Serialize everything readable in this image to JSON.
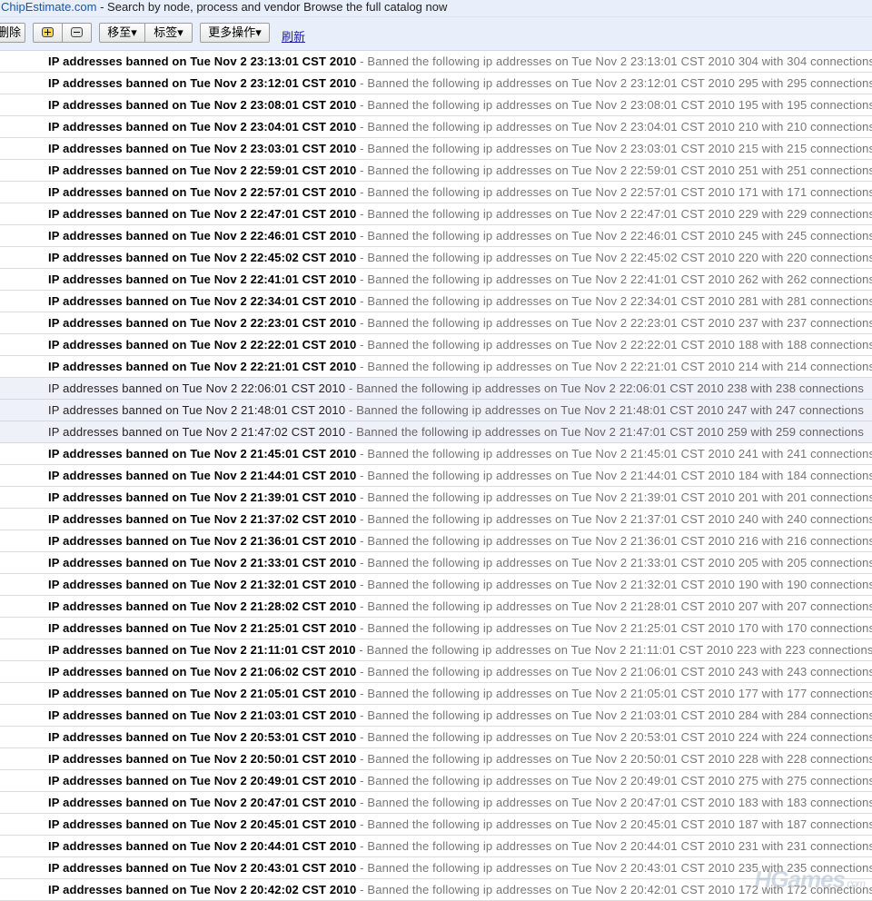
{
  "ad": {
    "link_text": "ChipEstimate.com",
    "text": " - Search by node, process and vendor Browse the full catalog now"
  },
  "toolbar": {
    "delete_label": "删除",
    "move_to_label": "移至▾",
    "labels_label": "标签▾",
    "more_actions_label": "更多操作▾",
    "refresh_label": "刷新"
  },
  "emails": [
    {
      "subject": "IP addresses banned on Tue Nov 2 23:13:01 CST 2010",
      "snippet": " - Banned the following ip addresses on Tue Nov 2 23:13:01 CST 2010 304 with 304 connections",
      "read": false
    },
    {
      "subject": "IP addresses banned on Tue Nov 2 23:12:01 CST 2010",
      "snippet": " - Banned the following ip addresses on Tue Nov 2 23:12:01 CST 2010 295 with 295 connections",
      "read": false
    },
    {
      "subject": "IP addresses banned on Tue Nov 2 23:08:01 CST 2010",
      "snippet": " - Banned the following ip addresses on Tue Nov 2 23:08:01 CST 2010 195 with 195 connections",
      "read": false
    },
    {
      "subject": "IP addresses banned on Tue Nov 2 23:04:01 CST 2010",
      "snippet": " - Banned the following ip addresses on Tue Nov 2 23:04:01 CST 2010 210 with 210 connections",
      "read": false
    },
    {
      "subject": "IP addresses banned on Tue Nov 2 23:03:01 CST 2010",
      "snippet": " - Banned the following ip addresses on Tue Nov 2 23:03:01 CST 2010 215 with 215 connections",
      "read": false
    },
    {
      "subject": "IP addresses banned on Tue Nov 2 22:59:01 CST 2010",
      "snippet": " - Banned the following ip addresses on Tue Nov 2 22:59:01 CST 2010 251 with 251 connections",
      "read": false
    },
    {
      "subject": "IP addresses banned on Tue Nov 2 22:57:01 CST 2010",
      "snippet": " - Banned the following ip addresses on Tue Nov 2 22:57:01 CST 2010 171 with 171 connections",
      "read": false
    },
    {
      "subject": "IP addresses banned on Tue Nov 2 22:47:01 CST 2010",
      "snippet": " - Banned the following ip addresses on Tue Nov 2 22:47:01 CST 2010 229 with 229 connections",
      "read": false
    },
    {
      "subject": "IP addresses banned on Tue Nov 2 22:46:01 CST 2010",
      "snippet": " - Banned the following ip addresses on Tue Nov 2 22:46:01 CST 2010 245 with 245 connections",
      "read": false
    },
    {
      "subject": "IP addresses banned on Tue Nov 2 22:45:02 CST 2010",
      "snippet": " - Banned the following ip addresses on Tue Nov 2 22:45:02 CST 2010 220 with 220 connections",
      "read": false
    },
    {
      "subject": "IP addresses banned on Tue Nov 2 22:41:01 CST 2010",
      "snippet": " - Banned the following ip addresses on Tue Nov 2 22:41:01 CST 2010 262 with 262 connections",
      "read": false
    },
    {
      "subject": "IP addresses banned on Tue Nov 2 22:34:01 CST 2010",
      "snippet": " - Banned the following ip addresses on Tue Nov 2 22:34:01 CST 2010 281 with 281 connections",
      "read": false
    },
    {
      "subject": "IP addresses banned on Tue Nov 2 22:23:01 CST 2010",
      "snippet": " - Banned the following ip addresses on Tue Nov 2 22:23:01 CST 2010 237 with 237 connections",
      "read": false
    },
    {
      "subject": "IP addresses banned on Tue Nov 2 22:22:01 CST 2010",
      "snippet": " - Banned the following ip addresses on Tue Nov 2 22:22:01 CST 2010 188 with 188 connections",
      "read": false
    },
    {
      "subject": "IP addresses banned on Tue Nov 2 22:21:01 CST 2010",
      "snippet": " - Banned the following ip addresses on Tue Nov 2 22:21:01 CST 2010 214 with 214 connections",
      "read": false
    },
    {
      "subject": "IP addresses banned on Tue Nov 2 22:06:01 CST 2010",
      "snippet": " - Banned the following ip addresses on Tue Nov 2 22:06:01 CST 2010 238 with 238 connections",
      "read": true
    },
    {
      "subject": "IP addresses banned on Tue Nov 2 21:48:01 CST 2010",
      "snippet": " - Banned the following ip addresses on Tue Nov 2 21:48:01 CST 2010 247 with 247 connections",
      "read": true
    },
    {
      "subject": "IP addresses banned on Tue Nov 2 21:47:02 CST 2010",
      "snippet": " - Banned the following ip addresses on Tue Nov 2 21:47:01 CST 2010 259 with 259 connections",
      "read": true
    },
    {
      "subject": "IP addresses banned on Tue Nov 2 21:45:01 CST 2010",
      "snippet": " - Banned the following ip addresses on Tue Nov 2 21:45:01 CST 2010 241 with 241 connections",
      "read": false
    },
    {
      "subject": "IP addresses banned on Tue Nov 2 21:44:01 CST 2010",
      "snippet": " - Banned the following ip addresses on Tue Nov 2 21:44:01 CST 2010 184 with 184 connections",
      "read": false
    },
    {
      "subject": "IP addresses banned on Tue Nov 2 21:39:01 CST 2010",
      "snippet": " - Banned the following ip addresses on Tue Nov 2 21:39:01 CST 2010 201 with 201 connections",
      "read": false
    },
    {
      "subject": "IP addresses banned on Tue Nov 2 21:37:02 CST 2010",
      "snippet": " - Banned the following ip addresses on Tue Nov 2 21:37:01 CST 2010 240 with 240 connections",
      "read": false
    },
    {
      "subject": "IP addresses banned on Tue Nov 2 21:36:01 CST 2010",
      "snippet": " - Banned the following ip addresses on Tue Nov 2 21:36:01 CST 2010 216 with 216 connections",
      "read": false
    },
    {
      "subject": "IP addresses banned on Tue Nov 2 21:33:01 CST 2010",
      "snippet": " - Banned the following ip addresses on Tue Nov 2 21:33:01 CST 2010 205 with 205 connections",
      "read": false
    },
    {
      "subject": "IP addresses banned on Tue Nov 2 21:32:01 CST 2010",
      "snippet": " - Banned the following ip addresses on Tue Nov 2 21:32:01 CST 2010 190 with 190 connections",
      "read": false
    },
    {
      "subject": "IP addresses banned on Tue Nov 2 21:28:02 CST 2010",
      "snippet": " - Banned the following ip addresses on Tue Nov 2 21:28:01 CST 2010 207 with 207 connections",
      "read": false
    },
    {
      "subject": "IP addresses banned on Tue Nov 2 21:25:01 CST 2010",
      "snippet": " - Banned the following ip addresses on Tue Nov 2 21:25:01 CST 2010 170 with 170 connections",
      "read": false
    },
    {
      "subject": "IP addresses banned on Tue Nov 2 21:11:01 CST 2010",
      "snippet": " - Banned the following ip addresses on Tue Nov 2 21:11:01 CST 2010 223 with 223 connections",
      "read": false
    },
    {
      "subject": "IP addresses banned on Tue Nov 2 21:06:02 CST 2010",
      "snippet": " - Banned the following ip addresses on Tue Nov 2 21:06:01 CST 2010 243 with 243 connections",
      "read": false
    },
    {
      "subject": "IP addresses banned on Tue Nov 2 21:05:01 CST 2010",
      "snippet": " - Banned the following ip addresses on Tue Nov 2 21:05:01 CST 2010 177 with 177 connections",
      "read": false
    },
    {
      "subject": "IP addresses banned on Tue Nov 2 21:03:01 CST 2010",
      "snippet": " - Banned the following ip addresses on Tue Nov 2 21:03:01 CST 2010 284 with 284 connections",
      "read": false
    },
    {
      "subject": "IP addresses banned on Tue Nov 2 20:53:01 CST 2010",
      "snippet": " - Banned the following ip addresses on Tue Nov 2 20:53:01 CST 2010 224 with 224 connections",
      "read": false
    },
    {
      "subject": "IP addresses banned on Tue Nov 2 20:50:01 CST 2010",
      "snippet": " - Banned the following ip addresses on Tue Nov 2 20:50:01 CST 2010 228 with 228 connections",
      "read": false
    },
    {
      "subject": "IP addresses banned on Tue Nov 2 20:49:01 CST 2010",
      "snippet": " - Banned the following ip addresses on Tue Nov 2 20:49:01 CST 2010 275 with 275 connections",
      "read": false
    },
    {
      "subject": "IP addresses banned on Tue Nov 2 20:47:01 CST 2010",
      "snippet": " - Banned the following ip addresses on Tue Nov 2 20:47:01 CST 2010 183 with 183 connections",
      "read": false
    },
    {
      "subject": "IP addresses banned on Tue Nov 2 20:45:01 CST 2010",
      "snippet": " - Banned the following ip addresses on Tue Nov 2 20:45:01 CST 2010 187 with 187 connections",
      "read": false
    },
    {
      "subject": "IP addresses banned on Tue Nov 2 20:44:01 CST 2010",
      "snippet": " - Banned the following ip addresses on Tue Nov 2 20:44:01 CST 2010 231 with 231 connections",
      "read": false
    },
    {
      "subject": "IP addresses banned on Tue Nov 2 20:43:01 CST 2010",
      "snippet": " - Banned the following ip addresses on Tue Nov 2 20:43:01 CST 2010 235 with 235 connections",
      "read": false
    },
    {
      "subject": "IP addresses banned on Tue Nov 2 20:42:02 CST 2010",
      "snippet": " - Banned the following ip addresses on Tue Nov 2 20:42:01 CST 2010 172 with 172 connections",
      "read": false
    }
  ],
  "watermark": {
    "brand": "HGames",
    "suffix": ".com"
  }
}
